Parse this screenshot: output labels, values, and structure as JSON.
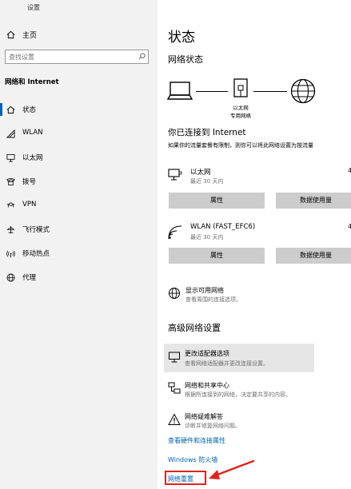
{
  "window": {
    "title": "设置"
  },
  "sidebar": {
    "home_label": "主页",
    "search_placeholder": "查找设置",
    "section_title": "网络和 Internet",
    "items": [
      {
        "label": "状态",
        "icon": "home-icon"
      },
      {
        "label": "WLAN",
        "icon": "wifi-icon"
      },
      {
        "label": "以太网",
        "icon": "ethernet-icon"
      },
      {
        "label": "拨号",
        "icon": "phone-icon"
      },
      {
        "label": "VPN",
        "icon": "vpn-icon"
      },
      {
        "label": "飞行模式",
        "icon": "airplane-icon"
      },
      {
        "label": "移动热点",
        "icon": "hotspot-icon"
      },
      {
        "label": "代理",
        "icon": "globe-icon"
      }
    ]
  },
  "main": {
    "page_title": "状态",
    "network_status_heading": "网络状态",
    "diagram_label_line1": "以太网",
    "diagram_label_line2": "专用网络",
    "connected_heading": "你已连接到 Internet",
    "connected_desc": "如果你的流量套餐有限制，则你可以将此网络设置为按流量",
    "connections": [
      {
        "name": "以太网",
        "detail": "最近 30 天内",
        "properties_label": "属性",
        "data_usage_label": "数据使用量"
      },
      {
        "name": "WLAN (FAST_EFC6)",
        "detail": "最近 30 天内",
        "properties_label": "属性",
        "data_usage_label": "数据使用量"
      }
    ],
    "show_networks": {
      "title": "显示可用网络",
      "desc": "查看周围的连接选项。"
    },
    "advanced_heading": "高级网络设置",
    "advanced_items": [
      {
        "title": "更改适配器选项",
        "desc": "查看网络适配器并更改连接设置。"
      },
      {
        "title": "网络和共享中心",
        "desc": "根据所连接到的网络，决定要共享的内容。"
      },
      {
        "title": "网络疑难解答",
        "desc": "诊断并修复网络问题。"
      }
    ],
    "links": {
      "hardware": "查看硬件和连接属性",
      "firewall": "Windows 防火墙",
      "reset": "网络重置"
    }
  },
  "colors": {
    "sidebar_bg": "#f2f2f2",
    "link": "#0063b1",
    "button_bg": "#cccccc",
    "highlight_bg": "#e6e6e6",
    "annotation_red": "#e0231b"
  }
}
